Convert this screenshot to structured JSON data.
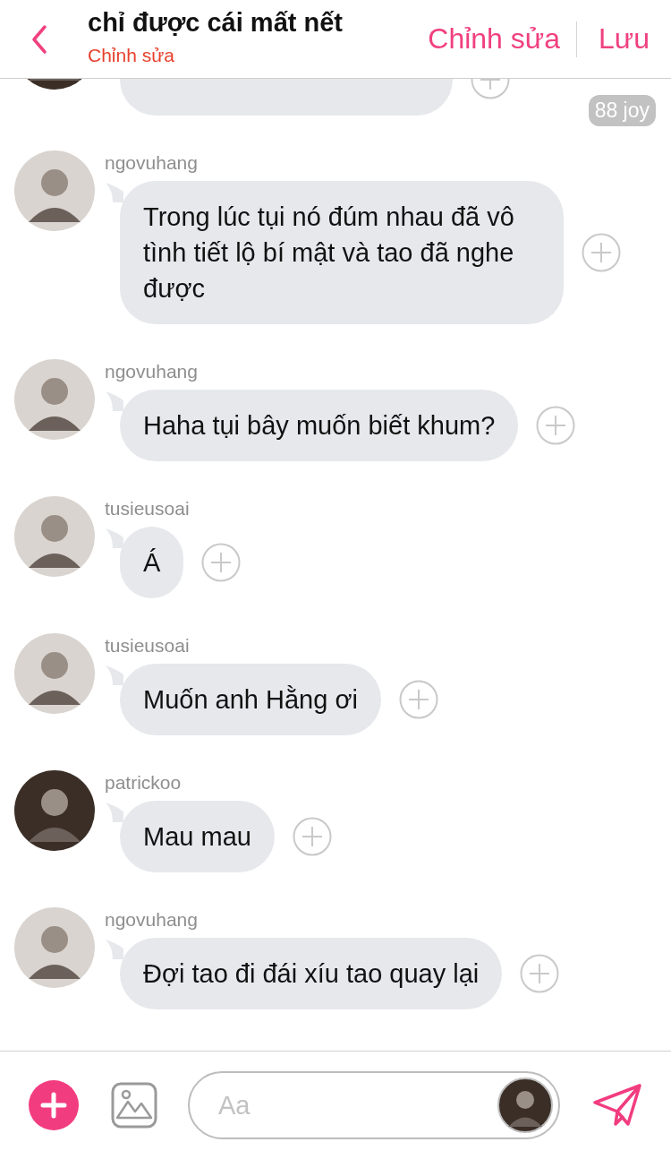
{
  "header": {
    "title": "chỉ được cái mất nết",
    "subtitle": "Chỉnh sửa",
    "actions": [
      "Chỉnh sửa",
      "Lưu"
    ]
  },
  "messages": [
    {
      "reaction": "88 joy"
    },
    {
      "user": "ngovuhang",
      "text": "Trong lúc tụi nó đúm nhau đã vô tình tiết lộ bí mật và tao đã nghe được"
    },
    {
      "user": "ngovuhang",
      "text": "Haha tụi bây muốn biết khum?"
    },
    {
      "user": "tusieusoai",
      "text": "Á"
    },
    {
      "user": "tusieusoai",
      "text": "Muốn anh Hằng ơi"
    },
    {
      "user": "patrickoo",
      "text": "Mau mau"
    },
    {
      "user": "ngovuhang",
      "text": "Đợi tao đi đái xíu tao quay lại"
    }
  ],
  "composer": {
    "placeholder": "Aa"
  }
}
